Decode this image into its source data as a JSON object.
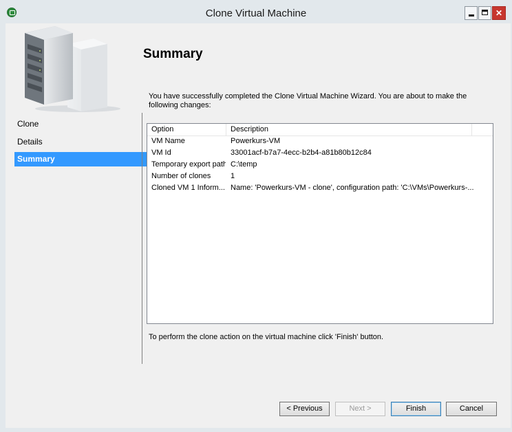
{
  "window": {
    "title": "Clone Virtual Machine"
  },
  "sidebar": {
    "items": [
      {
        "label": "Clone",
        "active": false
      },
      {
        "label": "Details",
        "active": false
      },
      {
        "label": "Summary",
        "active": true
      }
    ]
  },
  "main": {
    "title": "Summary",
    "intro": "You have successfully completed the Clone Virtual Machine Wizard. You are about to make the following changes:",
    "table": {
      "headers": [
        "Option",
        "Description"
      ],
      "rows": [
        [
          "VM Name",
          "Powerkurs-VM"
        ],
        [
          "VM Id",
          "33001acf-b7a7-4ecc-b2b4-a81b80b12c84"
        ],
        [
          "Temporary export path",
          "C:\\temp"
        ],
        [
          "Number of clones",
          "1"
        ],
        [
          "Cloned VM 1 Inform...",
          "Name: 'Powerkurs-VM - clone', configuration path: 'C:\\VMs\\Powerkurs-..."
        ]
      ]
    },
    "footer": "To perform the clone action on the virtual machine click 'Finish' button."
  },
  "buttons": {
    "previous": "< Previous",
    "next": "Next >",
    "finish": "Finish",
    "cancel": "Cancel"
  },
  "colors": {
    "accent": "#3399ff",
    "close": "#c7372f",
    "app_icon": "#2e8b3e"
  }
}
